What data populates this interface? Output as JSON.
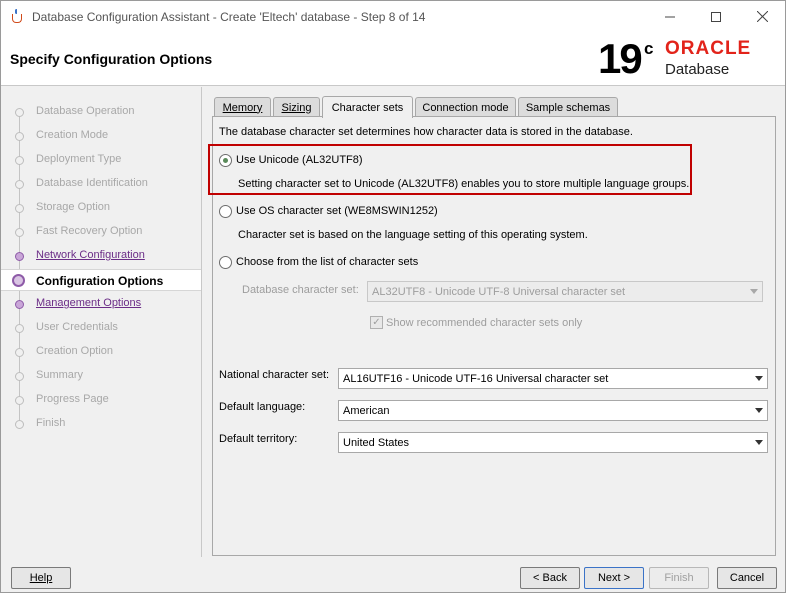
{
  "window": {
    "title": "Database Configuration Assistant - Create 'Eltech' database - Step 8 of 14"
  },
  "header": {
    "page_title": "Specify Configuration Options",
    "logo_version": "19",
    "logo_c": "c",
    "logo_brand": "ORACLE",
    "logo_product": "Database"
  },
  "steps": [
    {
      "label": "Database Operation",
      "state": "done"
    },
    {
      "label": "Creation Mode",
      "state": "done"
    },
    {
      "label": "Deployment Type",
      "state": "done"
    },
    {
      "label": "Database Identification",
      "state": "done"
    },
    {
      "label": "Storage Option",
      "state": "done"
    },
    {
      "label": "Fast Recovery Option",
      "state": "done"
    },
    {
      "label": "Network Configuration",
      "state": "link"
    },
    {
      "label": "Configuration Options",
      "state": "current"
    },
    {
      "label": "Management Options",
      "state": "link"
    },
    {
      "label": "User Credentials",
      "state": "pending"
    },
    {
      "label": "Creation Option",
      "state": "pending"
    },
    {
      "label": "Summary",
      "state": "pending"
    },
    {
      "label": "Progress Page",
      "state": "pending"
    },
    {
      "label": "Finish",
      "state": "pending"
    }
  ],
  "tabs": [
    {
      "label": "Memory"
    },
    {
      "label": "Sizing"
    },
    {
      "label": "Character sets",
      "active": true
    },
    {
      "label": "Connection mode"
    },
    {
      "label": "Sample schemas"
    }
  ],
  "charset": {
    "intro": "The database character set determines how character data is stored in the database.",
    "opt_unicode": "Use Unicode (AL32UTF8)",
    "opt_unicode_desc": "Setting character set to Unicode (AL32UTF8) enables you to store multiple language groups.",
    "opt_os": "Use OS character set (WE8MSWIN1252)",
    "opt_os_desc": "Character set is based on the language setting of this operating system.",
    "opt_list": "Choose from the list of character sets",
    "db_charset_label": "Database character set:",
    "db_charset_value": "AL32UTF8 - Unicode UTF-8 Universal character set",
    "show_recommended": "Show recommended character sets only",
    "national_label": "National character set:",
    "national_value": "AL16UTF16 - Unicode UTF-16 Universal character set",
    "language_label": "Default language:",
    "language_value": "American",
    "territory_label": "Default territory:",
    "territory_value": "United States"
  },
  "buttons": {
    "help": "Help",
    "back": "< Back",
    "next": "Next >",
    "finish": "Finish",
    "cancel": "Cancel"
  },
  "colors": {
    "highlight_border": "#c00000",
    "oracle_red": "#e2231a",
    "step_link": "#6b2d87"
  }
}
